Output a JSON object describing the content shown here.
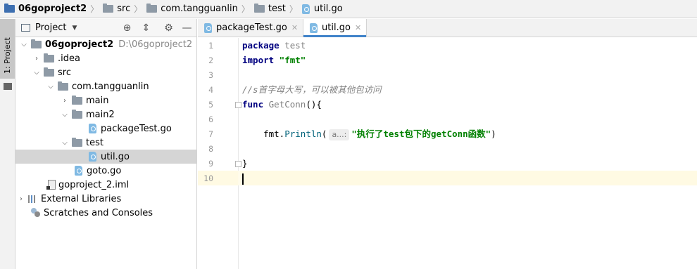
{
  "breadcrumb": [
    {
      "label": "06goproject2",
      "icon": "folder-icon"
    },
    {
      "label": "src",
      "icon": "folder-icon"
    },
    {
      "label": "com.tangguanlin",
      "icon": "folder-icon"
    },
    {
      "label": "test",
      "icon": "folder-icon"
    },
    {
      "label": "util.go",
      "icon": "go-file-icon"
    }
  ],
  "sidebar_strip": {
    "label": "1: Project"
  },
  "project_panel": {
    "title": "Project",
    "tree": [
      {
        "label": "06goproject2",
        "path": "D:\\06goproject2",
        "expanded": "open",
        "icon": "folder-icon"
      },
      {
        "label": ".idea",
        "expanded": "closed",
        "icon": "folder-icon"
      },
      {
        "label": "src",
        "expanded": "open",
        "icon": "folder-icon"
      },
      {
        "label": "com.tangguanlin",
        "expanded": "open",
        "icon": "folder-icon"
      },
      {
        "label": "main",
        "expanded": "closed",
        "icon": "folder-icon"
      },
      {
        "label": "main2",
        "expanded": "open",
        "icon": "folder-icon"
      },
      {
        "label": "packageTest.go",
        "icon": "go-file-icon"
      },
      {
        "label": "test",
        "expanded": "open",
        "icon": "folder-icon"
      },
      {
        "label": "util.go",
        "icon": "go-file-icon",
        "selected": true
      },
      {
        "label": "goto.go",
        "icon": "go-file-icon"
      },
      {
        "label": "goproject_2.iml",
        "icon": "iml-file-icon"
      },
      {
        "label": "External Libraries",
        "expanded": "closed",
        "icon": "library-icon"
      },
      {
        "label": "Scratches and Consoles",
        "icon": "scratches-icon"
      }
    ]
  },
  "tabs": [
    {
      "label": "packageTest.go",
      "active": false
    },
    {
      "label": "util.go",
      "active": true
    }
  ],
  "editor": {
    "line_numbers": [
      "1",
      "2",
      "3",
      "4",
      "5",
      "6",
      "7",
      "8",
      "9",
      "10"
    ],
    "current_line": 10,
    "code": {
      "l1_kw": "package",
      "l1_rest": " test",
      "l2_kw": "import",
      "l2_str": " \"fmt\"",
      "l4_comment": "//s首字母大写，可以被其他包访问",
      "l5_kw": "func",
      "l5_fn": " GetConn",
      "l5_rest": "(){",
      "l7_pkg": "    fmt.",
      "l7_fn": "Println",
      "l7_open": "(",
      "l7_hint": "a...:",
      "l7_str": "\"执行了test包下的getConn函数\"",
      "l7_close": ")",
      "l9_rest": "}"
    }
  }
}
